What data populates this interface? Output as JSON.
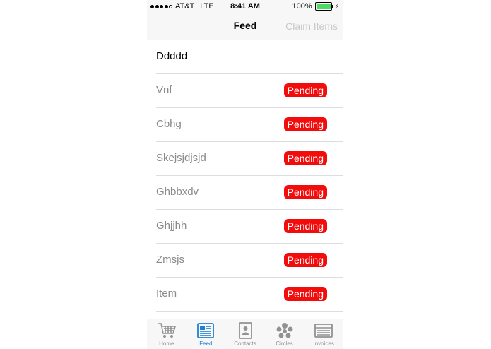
{
  "status": {
    "carrier": "AT&T",
    "network": "LTE",
    "time": "8:41 AM",
    "battery": "100%",
    "battery_level": 1.0
  },
  "nav": {
    "title": "Feed",
    "right_button": "Claim Items"
  },
  "list": {
    "header": "Ddddd",
    "items": [
      {
        "label": "Vnf",
        "status": "Pending"
      },
      {
        "label": "Cbhg",
        "status": "Pending"
      },
      {
        "label": "Skejsjdjsjd",
        "status": "Pending"
      },
      {
        "label": "Ghbbxdv",
        "status": "Pending"
      },
      {
        "label": "Ghjjhh",
        "status": "Pending"
      },
      {
        "label": "Zmsjs",
        "status": "Pending"
      },
      {
        "label": "Item",
        "status": "Pending"
      }
    ]
  },
  "tabs": [
    {
      "label": "Home",
      "icon": "cart-icon"
    },
    {
      "label": "Feed",
      "icon": "newspaper-icon",
      "active": true
    },
    {
      "label": "Contacts",
      "icon": "contact-card-icon"
    },
    {
      "label": "Circles",
      "icon": "people-circle-icon"
    },
    {
      "label": "Invoices",
      "icon": "invoice-icon"
    }
  ],
  "colors": {
    "badge": "#f20c0c",
    "active_tab": "#1f7fd3",
    "inactive_tab": "#929292",
    "battery": "#4cd964"
  }
}
